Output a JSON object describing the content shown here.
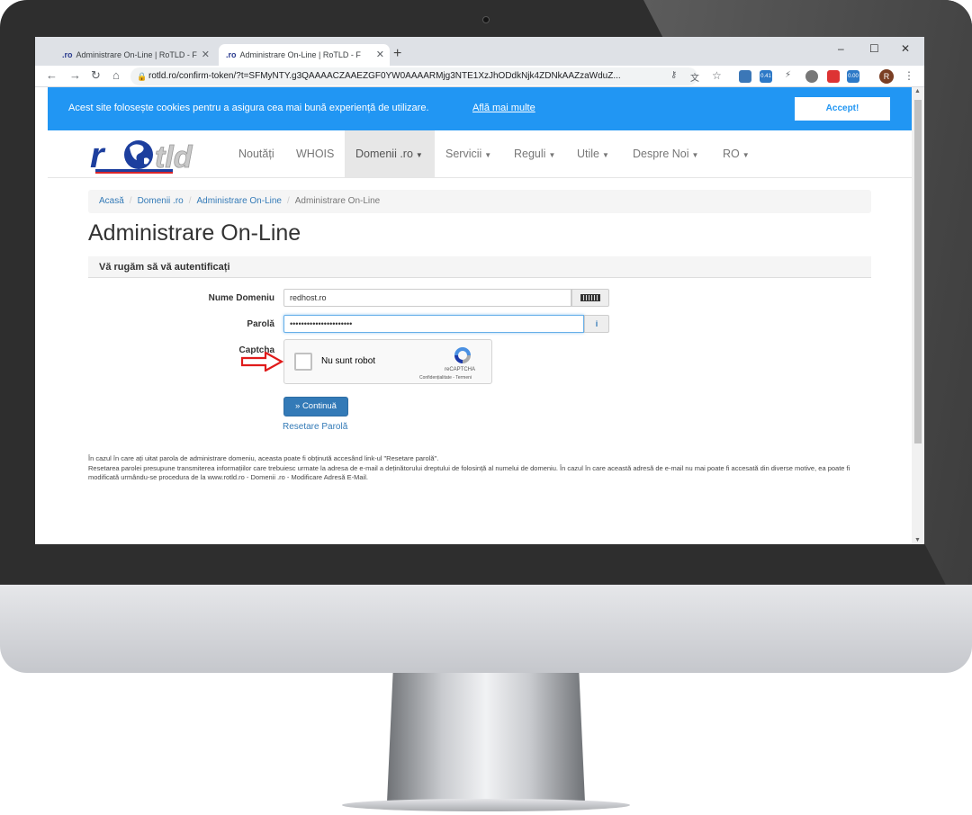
{
  "browser": {
    "tabs": [
      {
        "favicon": ".ro",
        "title": "Administrare On-Line | RoTLD - F",
        "active": false
      },
      {
        "favicon": ".ro",
        "title": "Administrare On-Line | RoTLD - F",
        "active": true
      }
    ],
    "new_tab": "+",
    "window_controls": {
      "minimize": "–",
      "maximize": "☐",
      "close": "✕"
    },
    "url": "rotld.ro/confirm-token/?t=SFMyNTY.g3QAAAACZAAEZGF0YW0AAAARMjg3NTE1XzJhODdkNjk4ZDNkAAZzaWduZ...",
    "extension_badges": {
      "one": "0.41",
      "two": "0.00"
    },
    "profile_initial": "R"
  },
  "cookie_bar": {
    "text": "Acest site folosește cookies pentru a asigura cea mai bună experiență de utilizare.",
    "link": "Află mai multe",
    "accept": "Accept!"
  },
  "navbar": {
    "logo_text": "rotld",
    "items": [
      {
        "label": "Noutăți",
        "dropdown": false,
        "active": false
      },
      {
        "label": "WHOIS",
        "dropdown": false,
        "active": false
      },
      {
        "label": "Domenii .ro",
        "dropdown": true,
        "active": true
      },
      {
        "label": "Servicii",
        "dropdown": true,
        "active": false
      },
      {
        "label": "Reguli",
        "dropdown": true,
        "active": false
      },
      {
        "label": "Utile",
        "dropdown": true,
        "active": false
      },
      {
        "label": "Despre Noi",
        "dropdown": true,
        "active": false
      },
      {
        "label": "RO",
        "dropdown": true,
        "active": false
      }
    ]
  },
  "breadcrumb": [
    "Acasă",
    "Domenii .ro",
    "Administrare On-Line",
    "Administrare On-Line"
  ],
  "page": {
    "title": "Administrare On-Line",
    "panel_heading": "Vă rugăm să vă autentificați"
  },
  "form": {
    "domain_label": "Nume Domeniu",
    "domain_value": "redhost.ro",
    "password_label": "Parolă",
    "password_value": "••••••••••••••••••••••",
    "password_info": "i",
    "captcha_label": "Captcha",
    "captcha_text": "Nu sunt robot",
    "recaptcha_brand": "reCAPTCHA",
    "recaptcha_terms": "Confidențialitate - Termeni",
    "submit": "» Continuă",
    "reset_link": "Resetare Parolă"
  },
  "help": {
    "line1": "În cazul în care ați uitat parola de administrare domeniu, aceasta poate fi obținută accesând link-ul \"Resetare parolă\".",
    "line2": "Resetarea parolei presupune transmiterea informațiilor care trebuiesc urmate la adresa de e-mail a deținătorului dreptului de folosință al numelui de domeniu. În cazul în care această adresă de e-mail nu mai poate fi accesată din diverse motive, ea poate fi modificată urmându-se procedura de la www.rotld.ro - Domenii .ro - Modificare Adresă E-Mail."
  },
  "colors": {
    "cookie_bar": "#2196f3",
    "link": "#337ab7",
    "button": "#337ab7",
    "annotation_arrow": "#e01b1b",
    "logo_blue": "#1d3f9e"
  }
}
